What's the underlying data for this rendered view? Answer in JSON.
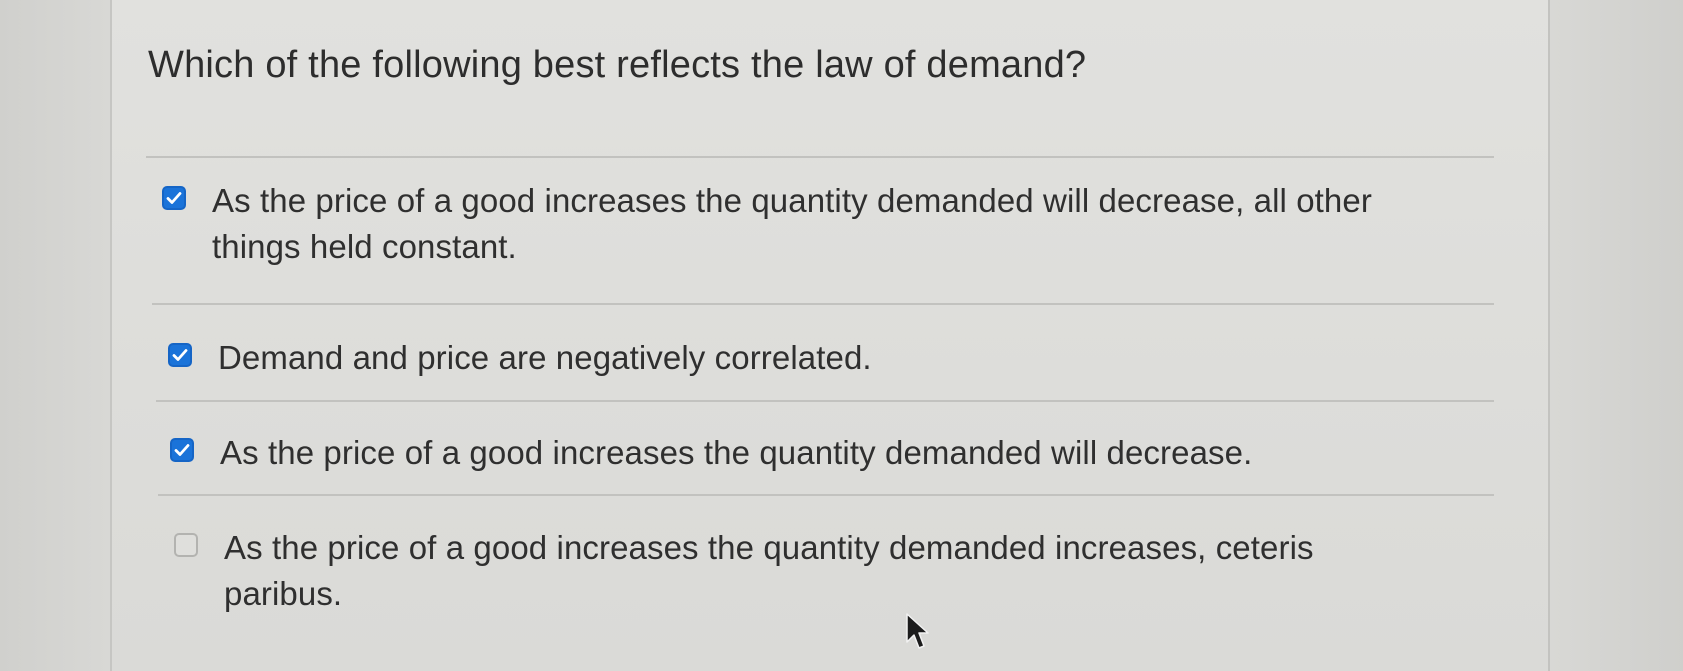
{
  "question": {
    "text": "Which of the following best reflects the law of demand?"
  },
  "options": [
    {
      "text": "As the price of a good increases the quantity demanded will decrease, all other things held constant.",
      "checked": true
    },
    {
      "text": "Demand and price are negatively correlated.",
      "checked": true
    },
    {
      "text": "As the price of a good increases the quantity demanded will decrease.",
      "checked": true
    },
    {
      "text": "As the price of a good increases the quantity demanded increases, ceteris paribus.",
      "checked": false
    }
  ],
  "colors": {
    "checkbox_checked": "#1a73d9",
    "text": "#2f2f2f",
    "background": "#dcdcd9"
  },
  "icons": {
    "checked": "check-icon",
    "cursor": "mouse-pointer-icon"
  }
}
